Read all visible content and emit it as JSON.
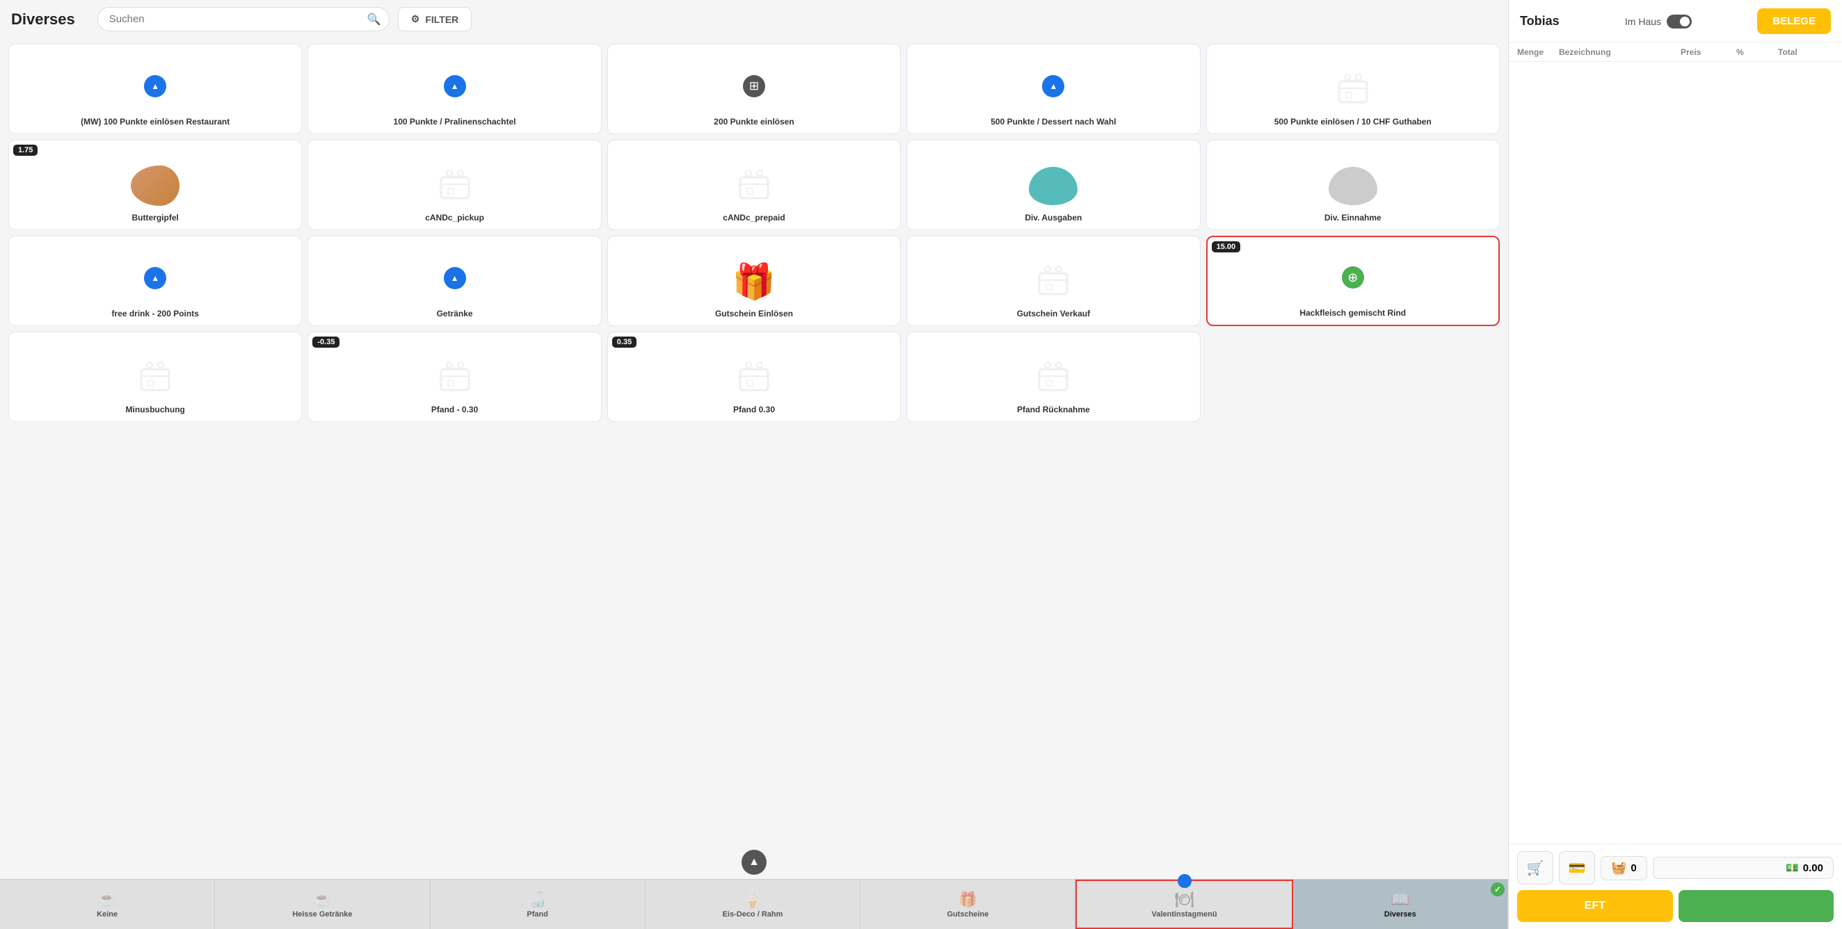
{
  "header": {
    "title": "Diverses",
    "search_placeholder": "Suchen",
    "filter_label": "FILTER"
  },
  "sidebar": {
    "user": "Tobias",
    "mode_label": "Im Haus",
    "belege_label": "BELEGE",
    "table_headers": {
      "menge": "Menge",
      "bezeichnung": "Bezeichnung",
      "preis": "Preis",
      "percent": "%",
      "total": "Total"
    },
    "cart_count": "0",
    "total": "0.00",
    "eft_label": "EFT"
  },
  "products": [
    {
      "id": "p1",
      "name": "(MW) 100 Punkte einlösen Restaurant",
      "type": "blue-arrow",
      "badge": null,
      "selected": false
    },
    {
      "id": "p2",
      "name": "100 Punkte / Pralinenschachtel",
      "type": "blue-arrow",
      "badge": null,
      "selected": false
    },
    {
      "id": "p3",
      "name": "200 Punkte einlösen",
      "type": "grid-icon",
      "badge": null,
      "selected": false
    },
    {
      "id": "p4",
      "name": "500 Punkte / Dessert nach Wahl",
      "type": "blue-arrow",
      "badge": null,
      "selected": false
    },
    {
      "id": "p5",
      "name": "500 Punkte einlösen / 10 CHF Guthaben",
      "type": "generic",
      "badge": null,
      "selected": false
    },
    {
      "id": "p6",
      "name": "Buttergipfel",
      "type": "croissant",
      "badge": "1.75",
      "selected": false
    },
    {
      "id": "p7",
      "name": "cANDc_pickup",
      "type": "generic",
      "badge": null,
      "selected": false
    },
    {
      "id": "p8",
      "name": "cANDc_prepaid",
      "type": "generic",
      "badge": null,
      "selected": false
    },
    {
      "id": "p9",
      "name": "Div. Ausgaben",
      "type": "piggy-blue",
      "badge": null,
      "selected": false
    },
    {
      "id": "p10",
      "name": "Div. Einnahme",
      "type": "piggy-white",
      "badge": null,
      "selected": false
    },
    {
      "id": "p11",
      "name": "free drink - 200 Points",
      "type": "blue-arrow",
      "badge": null,
      "selected": false
    },
    {
      "id": "p12",
      "name": "Getränke",
      "type": "blue-arrow",
      "badge": null,
      "selected": false
    },
    {
      "id": "p13",
      "name": "Gutschein Einlösen",
      "type": "gift-red",
      "badge": null,
      "selected": false
    },
    {
      "id": "p14",
      "name": "Gutschein Verkauf",
      "type": "generic",
      "badge": null,
      "selected": false
    },
    {
      "id": "p15",
      "name": "Hackfleisch gemischt Rind",
      "type": "green-plus",
      "badge": "15.00",
      "selected": true
    },
    {
      "id": "p16",
      "name": "Minusbuchung",
      "type": "generic",
      "badge": null,
      "selected": false
    },
    {
      "id": "p17",
      "name": "Pfand - 0.30",
      "type": "generic",
      "badge": "-0.35",
      "selected": false
    },
    {
      "id": "p18",
      "name": "Pfand 0.30",
      "type": "generic",
      "badge": "0.35",
      "selected": false
    },
    {
      "id": "p19",
      "name": "Pfand Rücknahme",
      "type": "generic",
      "badge": null,
      "selected": false
    }
  ],
  "tabs": [
    {
      "id": "t1",
      "label": "Keine",
      "icon": "coffee",
      "active": false,
      "selected": false,
      "check": false
    },
    {
      "id": "t2",
      "label": "Heisse Getränke",
      "icon": "coffee",
      "active": false,
      "selected": false,
      "check": false
    },
    {
      "id": "t3",
      "label": "Pfand",
      "icon": "bottle",
      "active": false,
      "selected": false,
      "check": false
    },
    {
      "id": "t4",
      "label": "Eis-Deco / Rahm",
      "icon": "ice",
      "active": false,
      "selected": false,
      "check": false
    },
    {
      "id": "t5",
      "label": "Gutscheine",
      "icon": "gift",
      "active": false,
      "selected": false,
      "check": false
    },
    {
      "id": "t6",
      "label": "Valentinstagmenü",
      "icon": "menu",
      "active": false,
      "selected": true,
      "check": false
    },
    {
      "id": "t7",
      "label": "Diverses",
      "icon": "book",
      "active": true,
      "selected": false,
      "check": true
    }
  ]
}
